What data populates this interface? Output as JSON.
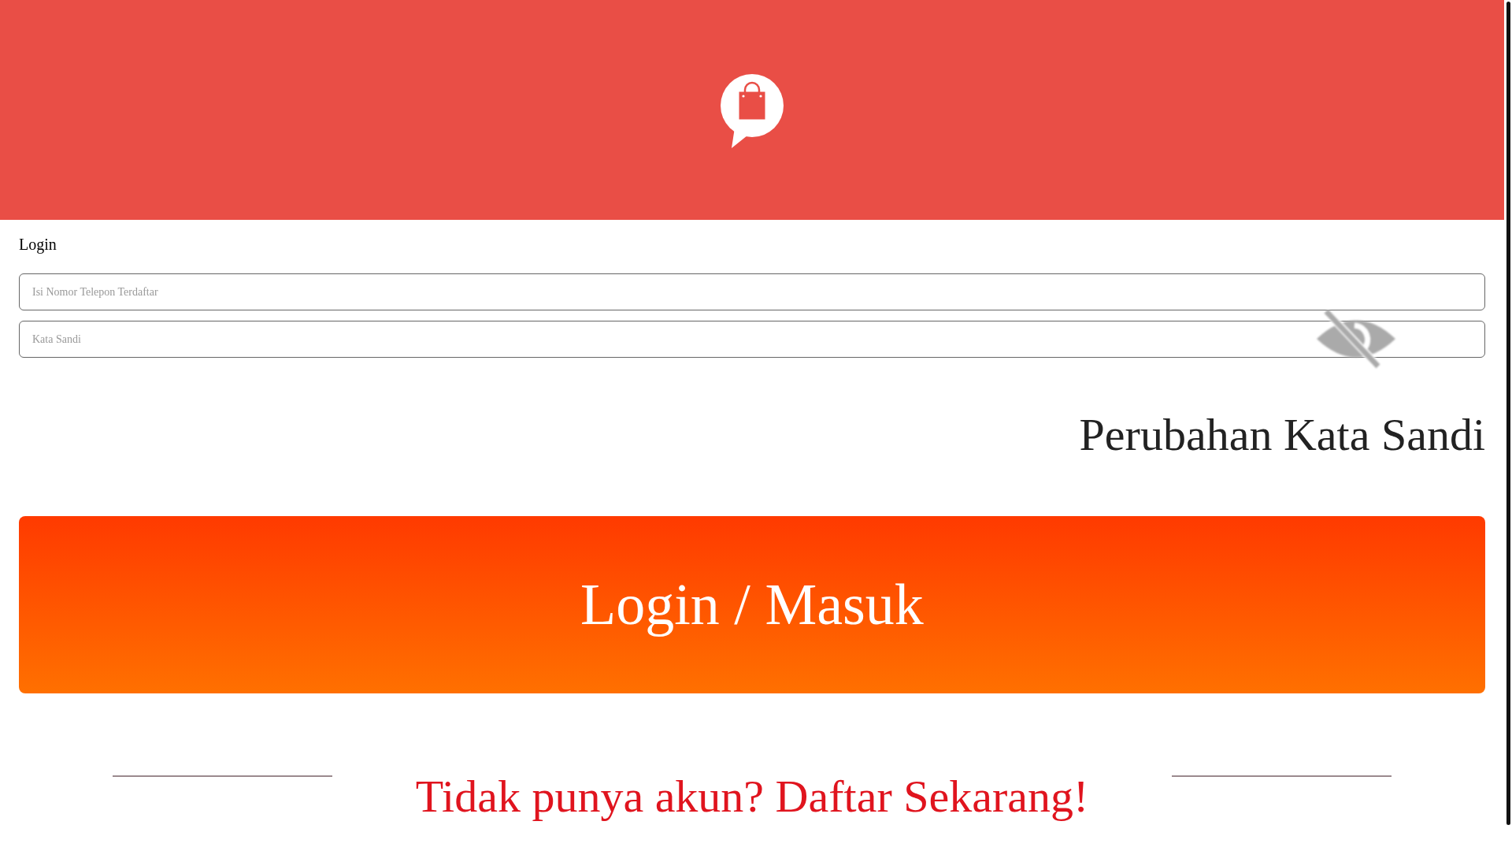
{
  "header": {
    "kind": "logo"
  },
  "form": {
    "title": "Login",
    "fields": [
      {
        "placeholder": "Isi Nomor Telepon Terdaftar",
        "kind": "text"
      },
      {
        "placeholder": "Kata Sandi",
        "kind": "password",
        "password_visible": false
      }
    ],
    "forgot_link": "Perubahan Kata Sandi",
    "submit_button": "Login / Masuk",
    "register_link": "Tidak punya akun? Daftar Sekarang!"
  }
}
